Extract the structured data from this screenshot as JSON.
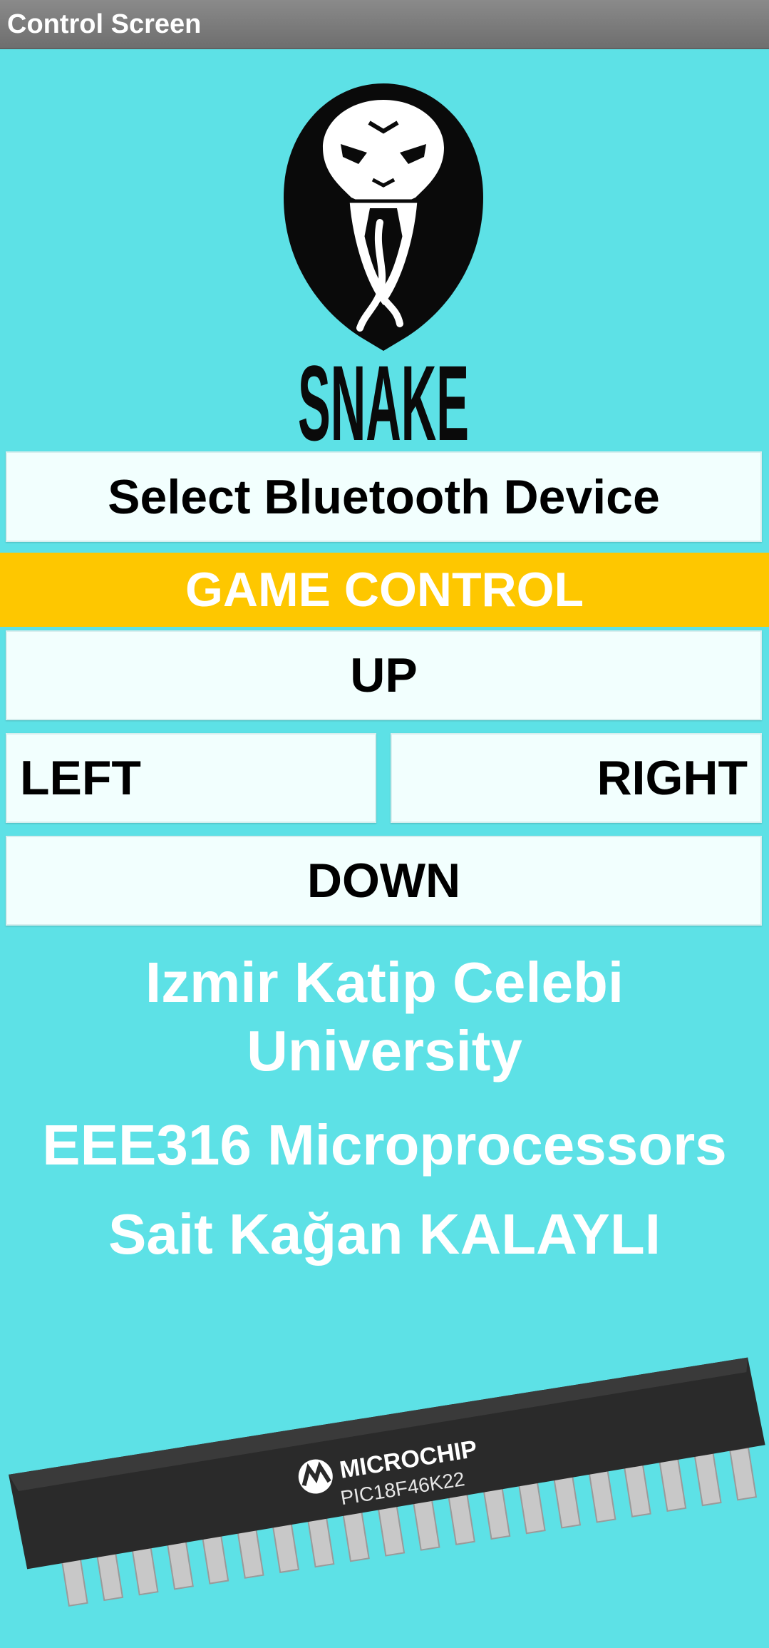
{
  "titlebar": {
    "title": "Control Screen"
  },
  "logo": {
    "text": "SNAKE"
  },
  "buttons": {
    "select_device": "Select Bluetooth Device",
    "up": "UP",
    "left": "LEFT",
    "right": "RIGHT",
    "down": "DOWN"
  },
  "banner": {
    "label": "GAME CONTROL"
  },
  "info": {
    "university": "Izmir Katip Celebi University",
    "course": "EEE316 Microprocessors",
    "author": "Sait Kağan KALAYLI"
  },
  "chip": {
    "brand": "MICROCHIP",
    "model": "PIC18F46K22"
  },
  "colors": {
    "background": "#5de1e6",
    "banner": "#fec700",
    "button": "#f2fffe"
  }
}
